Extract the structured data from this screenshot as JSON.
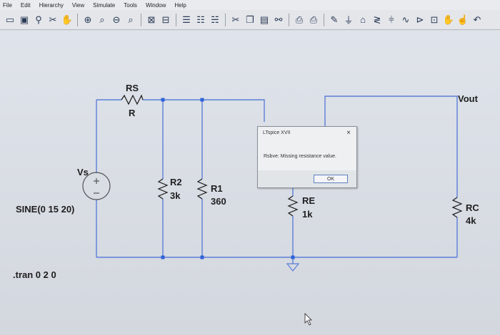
{
  "menu": [
    "File",
    "Edit",
    "Hierarchy",
    "View",
    "Simulate",
    "Tools",
    "Window",
    "Help"
  ],
  "toolbar_icons": [
    "open-icon",
    "save-icon",
    "component-icon",
    "tools-icon",
    "hand-icon",
    "zoom-in-icon",
    "zoom-area-icon",
    "zoom-out-icon",
    "zoom-fit-icon",
    "autorange-icon",
    "split-icon",
    "tile-icon",
    "cascade-icon",
    "layout-icon",
    "cut-icon",
    "copy-icon",
    "paste-icon",
    "find-icon",
    "print-setup-icon",
    "print-icon",
    "pencil-icon",
    "ground-icon",
    "label-icon",
    "resistor-icon",
    "capacitor-icon",
    "inductor-icon",
    "diode-icon",
    "component-library-icon",
    "move-icon",
    "drag-icon",
    "undo-icon"
  ],
  "schematic": {
    "source_name": "Vs",
    "source_value": "SINE(0 15 20)",
    "directive": ".tran 0 2 0",
    "rs_name": "RS",
    "rs_value": "R",
    "r2_name": "R2",
    "r2_value": "3k",
    "r1_name": "R1",
    "r1_value": "360",
    "re_name": "RE",
    "re_value": "1k",
    "rc_name": "RC",
    "rc_value": "4k",
    "net_label": "Vout"
  },
  "dialog": {
    "title": "LTspice XVII",
    "message": "Rsbve: Missing resistance value.",
    "ok_label": "OK",
    "close_glyph": "×"
  },
  "colors": {
    "wire": "#5b7fd8",
    "component": "#1a1a1a",
    "junction": "#2f62d8"
  }
}
